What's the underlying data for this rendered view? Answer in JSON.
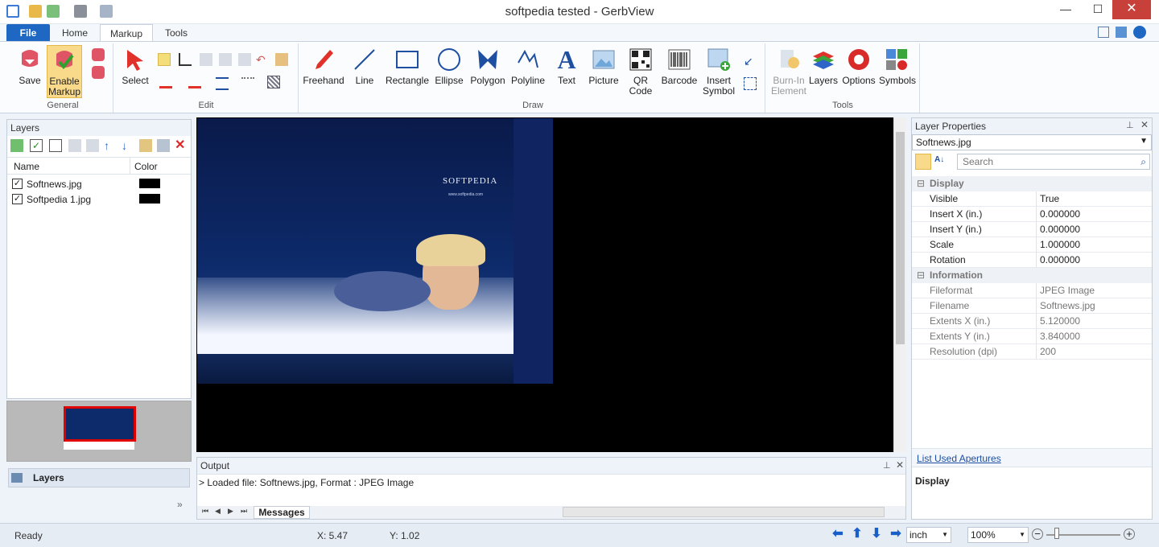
{
  "window": {
    "title": "softpedia tested - GerbView"
  },
  "ribbon_tabs": [
    {
      "label": "File"
    },
    {
      "label": "Home"
    },
    {
      "label": "Markup"
    },
    {
      "label": "Tools"
    }
  ],
  "ribbon": {
    "general": {
      "label": "General",
      "save": "Save",
      "enable_markup_1": "Enable",
      "enable_markup_2": "Markup"
    },
    "edit": {
      "label": "Edit",
      "select": "Select"
    },
    "draw": {
      "label": "Draw",
      "freehand": "Freehand",
      "line": "Line",
      "rectangle": "Rectangle",
      "ellipse": "Ellipse",
      "polygon": "Polygon",
      "polyline": "Polyline",
      "text": "Text",
      "picture": "Picture",
      "qr_1": "QR",
      "qr_2": "Code",
      "barcode": "Barcode",
      "insert_symbol_1": "Insert",
      "insert_symbol_2": "Symbol"
    },
    "tools": {
      "label": "Tools",
      "burnin_1": "Burn-In",
      "burnin_2": "Element",
      "layers": "Layers",
      "options": "Options",
      "symbols": "Symbols"
    }
  },
  "layers_panel": {
    "title": "Layers",
    "col_name": "Name",
    "col_color": "Color",
    "rows": [
      {
        "name": "Softnews.jpg",
        "checked": true
      },
      {
        "name": "Softpedia 1.jpg",
        "checked": true
      }
    ],
    "tab_label": "Layers"
  },
  "canvas": {
    "watermark": "SOFTPEDIA",
    "url": "www.softpedia.com"
  },
  "output": {
    "title": "Output",
    "line": "> Loaded file: Softnews.jpg, Format : JPEG Image",
    "tab": "Messages"
  },
  "props": {
    "title": "Layer Properties",
    "selected": "Softnews.jpg",
    "search_placeholder": "Search",
    "cat_display": "Display",
    "display_rows": [
      {
        "k": "Visible",
        "v": "True"
      },
      {
        "k": "Insert X (in.)",
        "v": "0.000000"
      },
      {
        "k": "Insert Y (in.)",
        "v": "0.000000"
      },
      {
        "k": "Scale",
        "v": "1.000000"
      },
      {
        "k": "Rotation",
        "v": "0.000000"
      }
    ],
    "cat_info": "Information",
    "info_rows": [
      {
        "k": "Fileformat",
        "v": "JPEG Image"
      },
      {
        "k": "Filename",
        "v": "Softnews.jpg"
      },
      {
        "k": "Extents X (in.)",
        "v": "5.120000"
      },
      {
        "k": "Extents Y (in.)",
        "v": "3.840000"
      },
      {
        "k": "Resolution (dpi)",
        "v": "200"
      }
    ],
    "link": "List Used Apertures",
    "desc_title": "Display"
  },
  "status": {
    "ready": "Ready",
    "x": "X: 5.47",
    "y": "Y: 1.02",
    "unit": "inch",
    "zoom": "100%"
  },
  "colors": {
    "accent": "#1e68c4",
    "close": "#c7403a"
  }
}
